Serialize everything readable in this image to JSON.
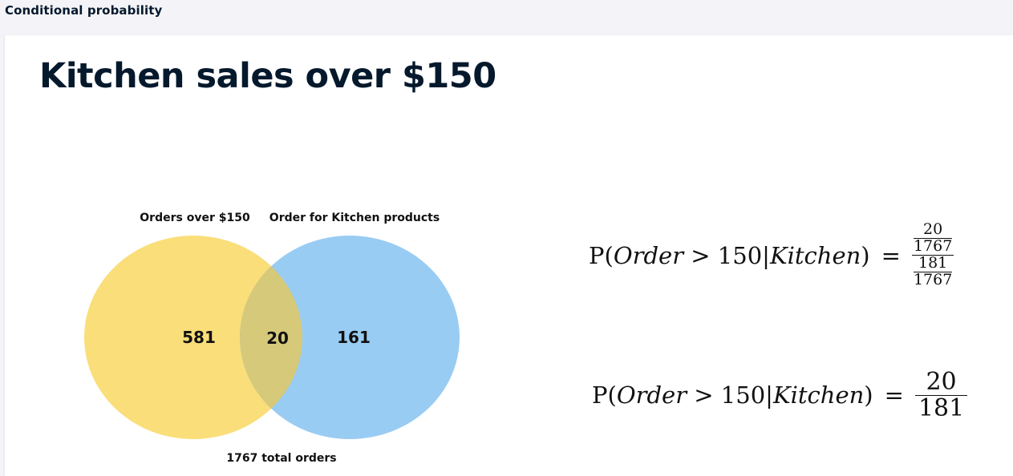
{
  "breadcrumb": "Conditional probability",
  "slide": {
    "title": "Kitchen sales over $150"
  },
  "venn": {
    "label_left": "Orders over $150",
    "label_right": "Order for Kitchen products",
    "only_left": "581",
    "both": "20",
    "only_right": "161",
    "total_label": "1767 total orders",
    "colors": {
      "left": "#fade7a",
      "right": "#99ccf3",
      "overlap": "#d6c97a"
    }
  },
  "formula1": {
    "lhs_p": "P(",
    "lhs_order": "Order",
    "lhs_gt": " > 150",
    "lhs_bar": "|",
    "lhs_kitchen": "Kitchen",
    "lhs_close": ")",
    "eq": "=",
    "num_num": "20",
    "num_den": "1767",
    "den_num": "181",
    "den_den": "1767"
  },
  "formula2": {
    "lhs_p": "P(",
    "lhs_order": "Order",
    "lhs_gt": " > 150",
    "lhs_bar": "|",
    "lhs_kitchen": "Kitchen",
    "lhs_close": ")",
    "eq": "=",
    "num": "20",
    "den": "181"
  }
}
